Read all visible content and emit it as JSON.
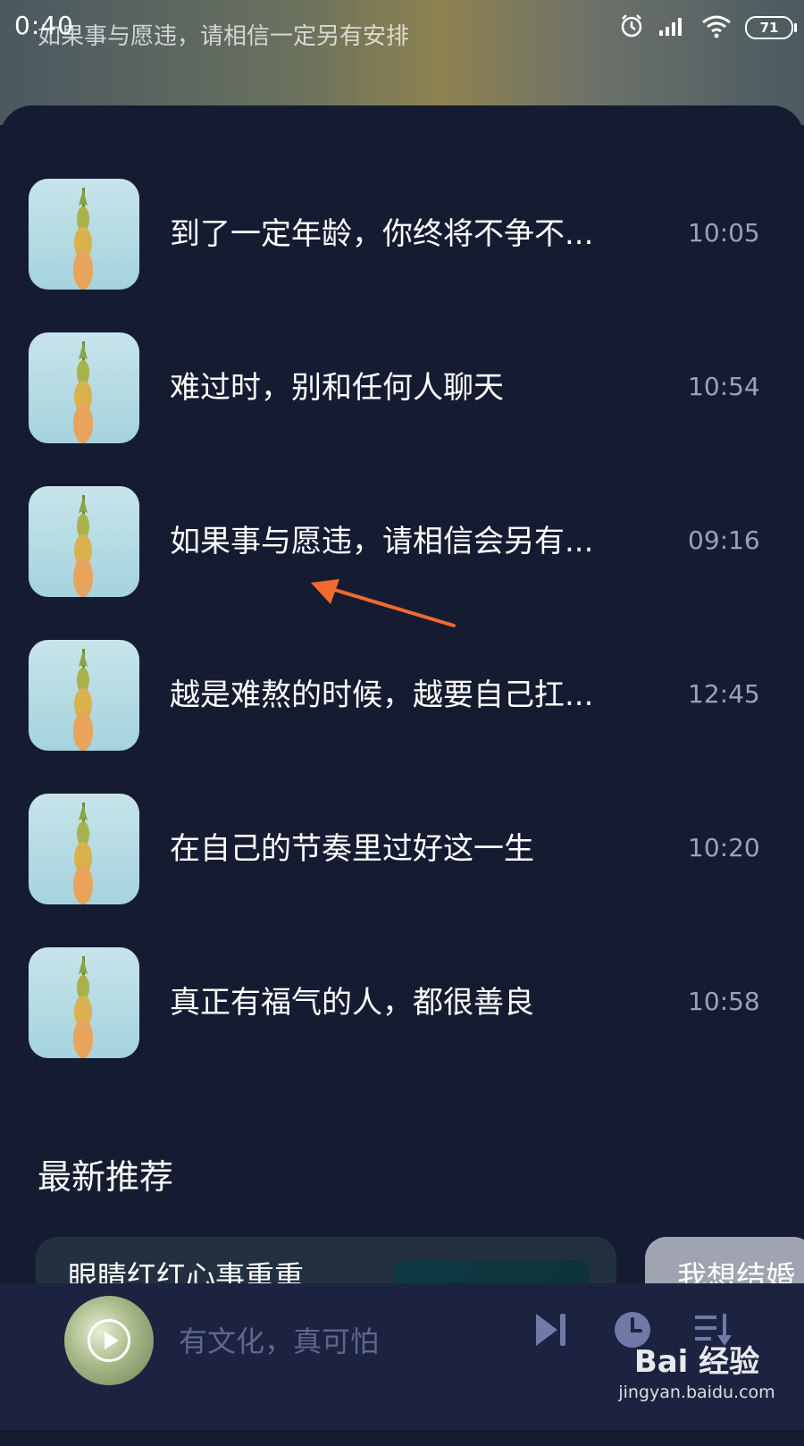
{
  "status_bar": {
    "time": "0:40",
    "marquee": "如果事与愿违，请相信一定另有安排",
    "battery": "71"
  },
  "list": {
    "items": [
      {
        "title": "到了一定年龄，你终将不争不...",
        "time": "10:05"
      },
      {
        "title": "难过时，别和任何人聊天",
        "time": "10:54"
      },
      {
        "title": "如果事与愿违，请相信会另有...",
        "time": "09:16"
      },
      {
        "title": "越是难熬的时候，越要自己扛...",
        "time": "12:45"
      },
      {
        "title": "在自己的节奏里过好这一生",
        "time": "10:20"
      },
      {
        "title": "真正有福气的人，都很善良",
        "time": "10:58"
      }
    ]
  },
  "recommend": {
    "title": "最新推荐",
    "cards": [
      {
        "title": "眼睛红红心事重重"
      },
      {
        "title": "我想结婚"
      }
    ]
  },
  "player": {
    "track": "有文化，真可怕"
  },
  "watermark": {
    "logo": "Bai 经验",
    "url": "jingyan.baidu.com"
  },
  "colors": {
    "background": "#151c32",
    "player_bar": "#1b2340",
    "annotation_arrow": "#f26a2e",
    "secondary_text": "#9ba2b8"
  }
}
